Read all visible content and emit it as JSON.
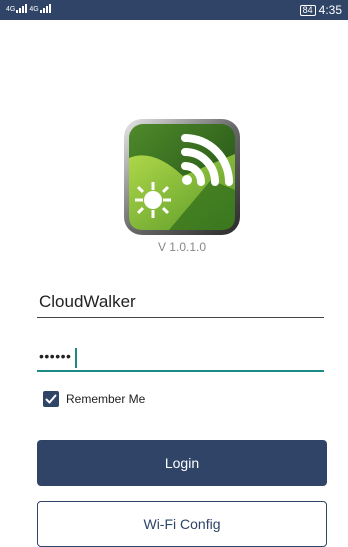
{
  "status_bar": {
    "network_1": "4G",
    "network_2": "4G",
    "battery": "84",
    "time": "4:35"
  },
  "app": {
    "logo_icon": "wifi-sun-logo-icon",
    "version": "V 1.0.1.0"
  },
  "form": {
    "username_value": "CloudWalker",
    "password_masked": "••••••",
    "remember_label": "Remember Me",
    "remember_checked": true
  },
  "buttons": {
    "login_label": "Login",
    "wifi_config_label": "Wi-Fi Config"
  },
  "colors": {
    "primary": "#2f4467",
    "accent": "#1a8b86",
    "background": "#ffffff"
  }
}
